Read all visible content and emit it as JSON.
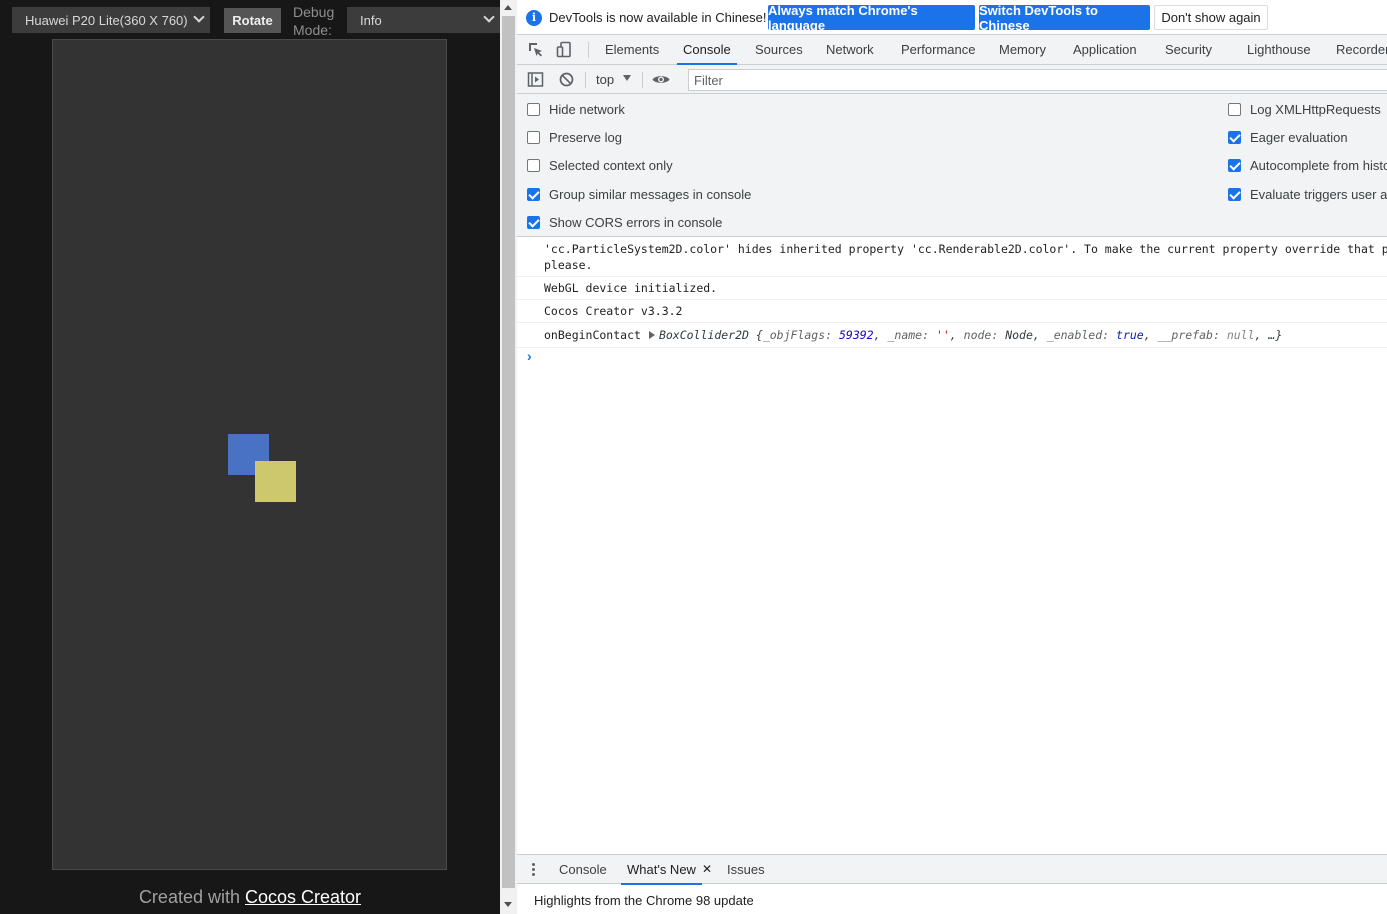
{
  "preview": {
    "device": "Huawei P20 Lite(360 X 760)",
    "rotate_label": "Rotate",
    "debug_label": "Debug Mode:",
    "debug_mode": "Info",
    "credit_prefix": "Created with ",
    "credit_link": "Cocos Creator",
    "colors": {
      "canvas": "#333333",
      "box_blue": "#4a72c4",
      "box_yellow": "#cdc86d"
    }
  },
  "infobar": {
    "message": "DevTools is now available in Chinese!",
    "btn_match": "Always match Chrome's language",
    "btn_switch": "Switch DevTools to Chinese",
    "btn_dont": "Don't show again"
  },
  "tabs": [
    "Elements",
    "Console",
    "Sources",
    "Network",
    "Performance",
    "Memory",
    "Application",
    "Security",
    "Lighthouse",
    "Recorder"
  ],
  "active_tab": "Console",
  "console_toolbar": {
    "context": "top",
    "filter_placeholder": "Filter"
  },
  "settings": {
    "left": [
      {
        "label": "Hide network",
        "checked": false
      },
      {
        "label": "Preserve log",
        "checked": false
      },
      {
        "label": "Selected context only",
        "checked": false
      },
      {
        "label": "Group similar messages in console",
        "checked": true
      },
      {
        "label": "Show CORS errors in console",
        "checked": true
      }
    ],
    "right": [
      {
        "label": "Log XMLHttpRequests",
        "checked": false
      },
      {
        "label": "Eager evaluation",
        "checked": true
      },
      {
        "label": "Autocomplete from history",
        "checked": true
      },
      {
        "label": "Evaluate triggers user activation",
        "checked": true
      }
    ]
  },
  "console": {
    "line1a": "'cc.ParticleSystem2D.color' hides inherited property 'cc.Renderable2D.color'. To make the current property override that property",
    "line1b": "please.",
    "line2": "WebGL device initialized.",
    "line3": "Cocos Creator v3.3.2",
    "line4_label": "onBeginContact",
    "line4_type": "BoxCollider2D",
    "line4_obj": {
      "k1": "_objFlags: ",
      "v1": "59392",
      "k2": "_name: ",
      "v2": "''",
      "k3": "node: ",
      "v3": "Node",
      "k4": "_enabled: ",
      "v4": "true",
      "k5": "__prefab: ",
      "v5": "null",
      "tail": "…}"
    },
    "prompt": "›"
  },
  "drawer": {
    "tabs": [
      "Console",
      "What's New",
      "Issues"
    ],
    "active": "What's New",
    "close": "✕",
    "content": "Highlights from the Chrome 98 update"
  }
}
